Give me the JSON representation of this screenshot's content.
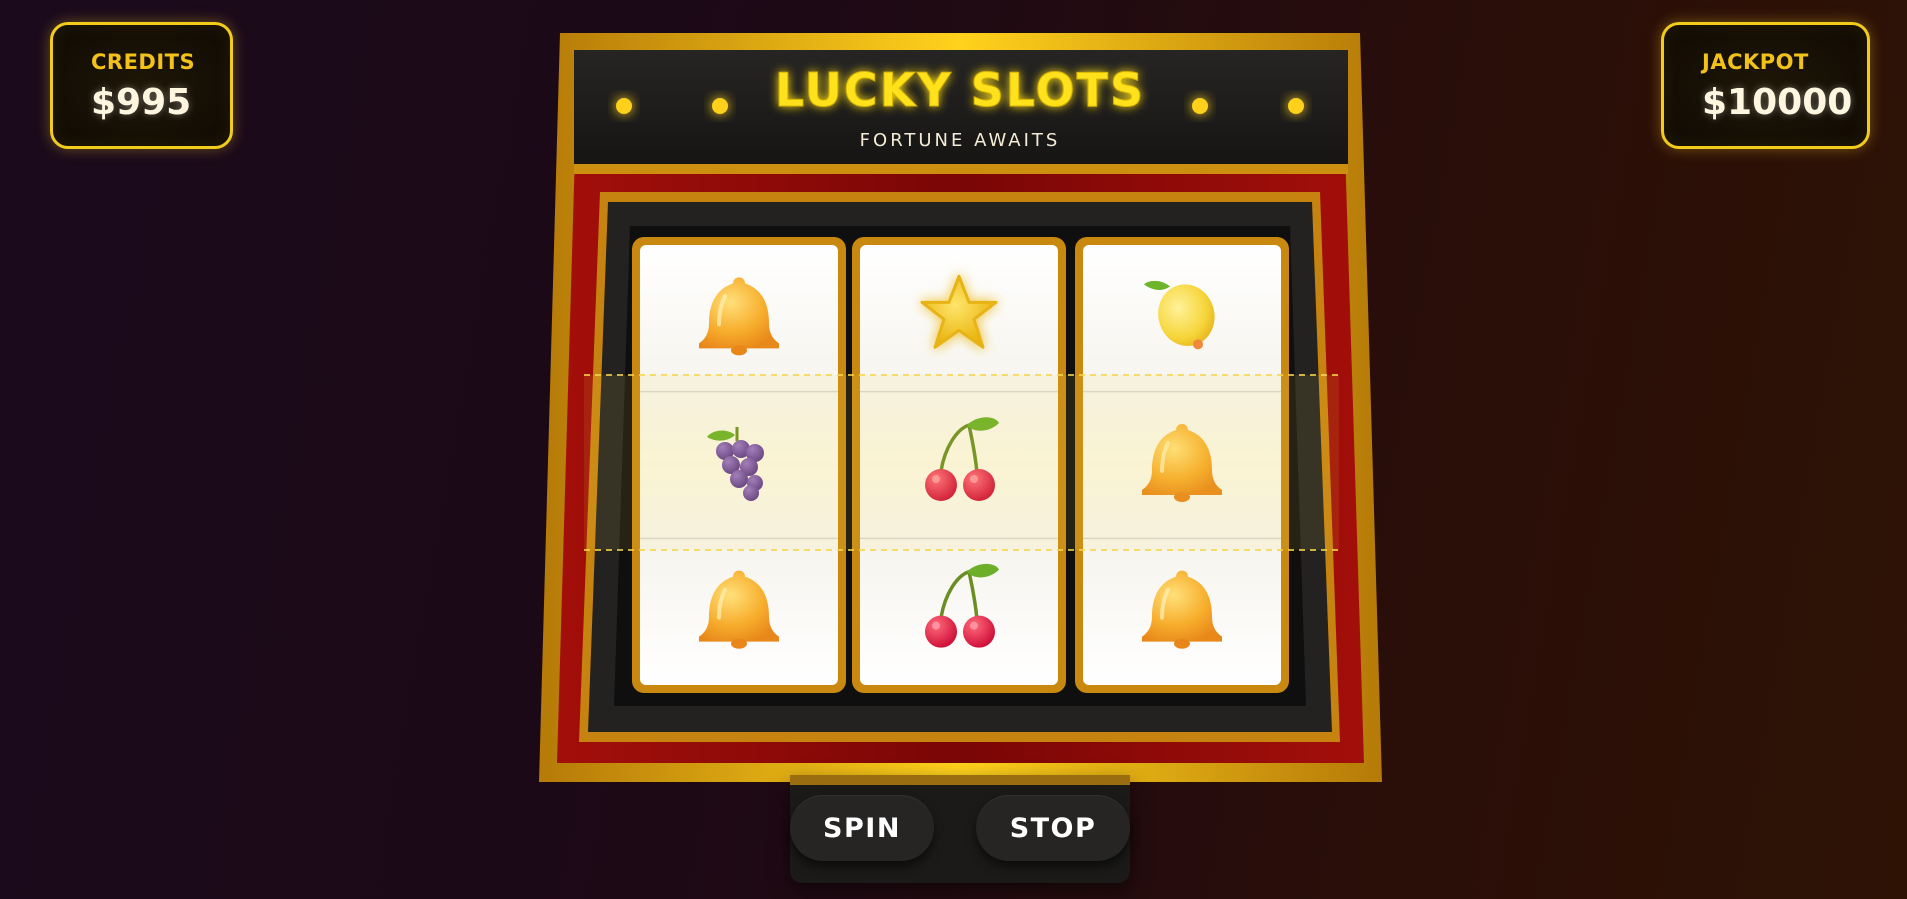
{
  "credits": {
    "label": "CREDITS",
    "value": "$995"
  },
  "jackpot": {
    "label": "JACKPOT",
    "value": "$10000"
  },
  "title": "LUCKY SLOTS",
  "subtitle": "FORTUNE AWAITS",
  "reels": [
    [
      "bell",
      "grapes",
      "bell"
    ],
    [
      "star",
      "cherries",
      "cherries"
    ],
    [
      "lemon",
      "bell",
      "bell"
    ]
  ],
  "controls": {
    "spin_label": "SPIN",
    "stop_label": "STOP"
  },
  "colors": {
    "gold": "#f2cc1b",
    "frame_red": "#8a0a08",
    "reel_bg": "#f7f7f5",
    "payline": "#f5d64a"
  }
}
